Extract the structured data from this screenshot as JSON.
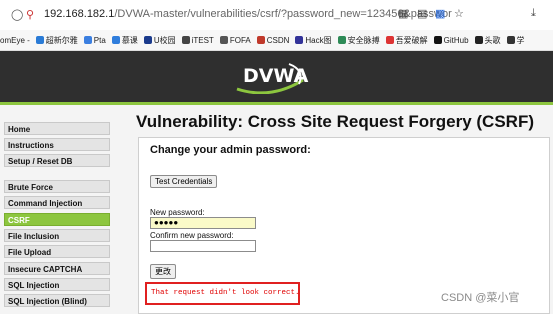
{
  "browser": {
    "url_host": "192.168.182.1",
    "url_path": "/DVWA-master/vulnerabilities/csrf/?password_new=123456&passwor",
    "icons": [
      "shield-icon",
      "lock-slash-icon",
      "qr-icon",
      "reader-icon",
      "translate-icon",
      "star-icon",
      "download-icon"
    ]
  },
  "bookmarks": [
    {
      "label": "omEye -",
      "color": "#ffffff"
    },
    {
      "label": "超新尔雅",
      "color": "#2a7bd6"
    },
    {
      "label": "Pta",
      "color": "#3b7fe0"
    },
    {
      "label": "慕课",
      "color": "#2f7ddc"
    },
    {
      "label": "U校园",
      "color": "#1a3a8c"
    },
    {
      "label": "iTEST",
      "color": "#444444"
    },
    {
      "label": "FOFA",
      "color": "#555555"
    },
    {
      "label": "CSDN",
      "color": "#c0392b"
    },
    {
      "label": "Hack图",
      "color": "#333399"
    },
    {
      "label": "安全脉搏",
      "color": "#2e8b57"
    },
    {
      "label": "吾爱破解",
      "color": "#d33"
    },
    {
      "label": "GitHub",
      "color": "#111111"
    },
    {
      "label": "头歌",
      "color": "#222222"
    },
    {
      "label": "学",
      "color": "#333333"
    }
  ],
  "header": {
    "logo_text": "DVWA"
  },
  "sidebar": {
    "items": [
      {
        "label": "Home",
        "active": false
      },
      {
        "label": "Instructions",
        "active": false
      },
      {
        "label": "Setup / Reset DB",
        "active": false
      },
      {
        "label": "Brute Force",
        "active": false
      },
      {
        "label": "Command Injection",
        "active": false
      },
      {
        "label": "CSRF",
        "active": true
      },
      {
        "label": "File Inclusion",
        "active": false
      },
      {
        "label": "File Upload",
        "active": false
      },
      {
        "label": "Insecure CAPTCHA",
        "active": false
      },
      {
        "label": "SQL Injection",
        "active": false
      },
      {
        "label": "SQL Injection (Blind)",
        "active": false
      }
    ]
  },
  "main": {
    "title": "Vulnerability: Cross Site Request Forgery (CSRF)",
    "subtitle": "Change your admin password:",
    "test_button": "Test Credentials",
    "new_password_label": "New password:",
    "new_password_value": "●●●●●",
    "confirm_label": "Confirm new password:",
    "confirm_value": "",
    "change_button": "更改",
    "error_text": "That request didn't look correct."
  },
  "watermark": "CSDN @菜小官",
  "colors": {
    "accent": "#8dc63f",
    "header_bg": "#2f2f2f",
    "error": "#e00000"
  }
}
